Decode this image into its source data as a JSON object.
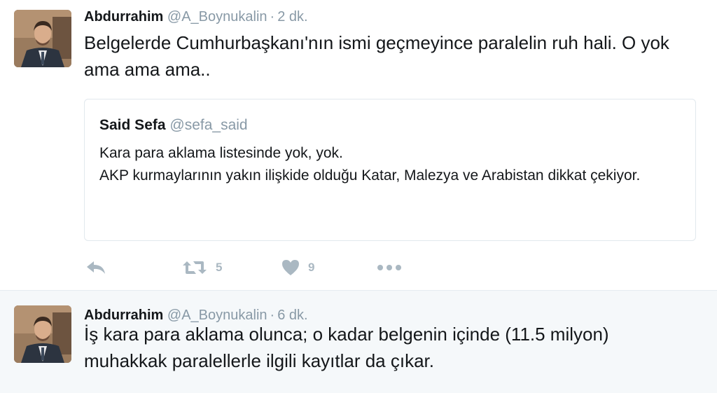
{
  "tweets": [
    {
      "author_name": "Abdurrahim",
      "handle": "@A_Boynukalin",
      "separator": "·",
      "time": "2 dk.",
      "text": "Belgelerde Cumhurbaşkanı'nın ismi geçmeyince paralelin ruh hali. O yok ama ama ama..",
      "quoted": {
        "author_name": "Said Sefa",
        "handle": "@sefa_said",
        "lines": [
          "Kara para aklama listesinde yok, yok.",
          "AKP kurmaylarının yakın ilişkide olduğu Katar, Malezya ve Arabistan dikkat çekiyor."
        ]
      },
      "actions": {
        "reply_icon": "reply-icon",
        "retweet_icon": "retweet-icon",
        "retweet_count": "5",
        "like_icon": "heart-icon",
        "like_count": "9",
        "more_icon": "more-icon"
      }
    },
    {
      "author_name": "Abdurrahim",
      "handle": "@A_Boynukalin",
      "separator": "·",
      "time": "6 dk.",
      "text": "İş kara para aklama olunca; o kadar belgenin içinde (11.5 milyon) muhakkak paralellerle ilgili kayıtlar da çıkar."
    }
  ],
  "colors": {
    "muted": "#8899a6",
    "icon": "#aab8c2",
    "text": "#14171a",
    "highlight_bg": "#f5f8fa",
    "border": "#e1e8ed"
  }
}
